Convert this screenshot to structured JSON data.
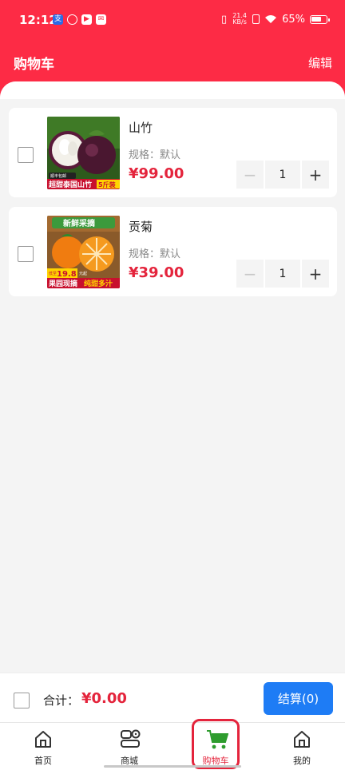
{
  "status_bar": {
    "time": "12:12",
    "net_speed_value": "21.4",
    "net_speed_unit": "KB/s",
    "battery_text": "65%"
  },
  "header": {
    "title": "购物车",
    "edit_label": "编辑"
  },
  "cart": {
    "items": [
      {
        "name": "山竹",
        "spec": "规格：默认",
        "price": "¥99.00",
        "quantity": "1",
        "minus": "−",
        "plus": "+",
        "image_banner": "超甜泰国山竹",
        "image_badge": "5斤装",
        "image_logo": "顺丰包邮"
      },
      {
        "name": "贡菊",
        "spec": "规格：默认",
        "price": "¥39.00",
        "quantity": "1",
        "minus": "−",
        "plus": "+",
        "image_top_banner": "新鲜采摘",
        "image_price_prefix": "低至",
        "image_price": "19.8",
        "image_price_unit": "元起",
        "image_bottom_left": "果园现摘",
        "image_bottom_right": "纯甜多汁"
      }
    ]
  },
  "checkout": {
    "total_label": "合计：",
    "total_value": "¥0.00",
    "button_label": "结算(0)"
  },
  "tabbar": {
    "tabs": [
      {
        "label": "首页",
        "icon": "home-icon"
      },
      {
        "label": "商城",
        "icon": "store-icon"
      },
      {
        "label": "购物车",
        "icon": "cart-icon",
        "active": true
      },
      {
        "label": "我的",
        "icon": "profile-home-icon"
      }
    ]
  },
  "colors": {
    "header": "#fd2b45",
    "price": "#e4243c",
    "button": "#1e7cf5",
    "cart_icon": "#2e9c2e"
  }
}
